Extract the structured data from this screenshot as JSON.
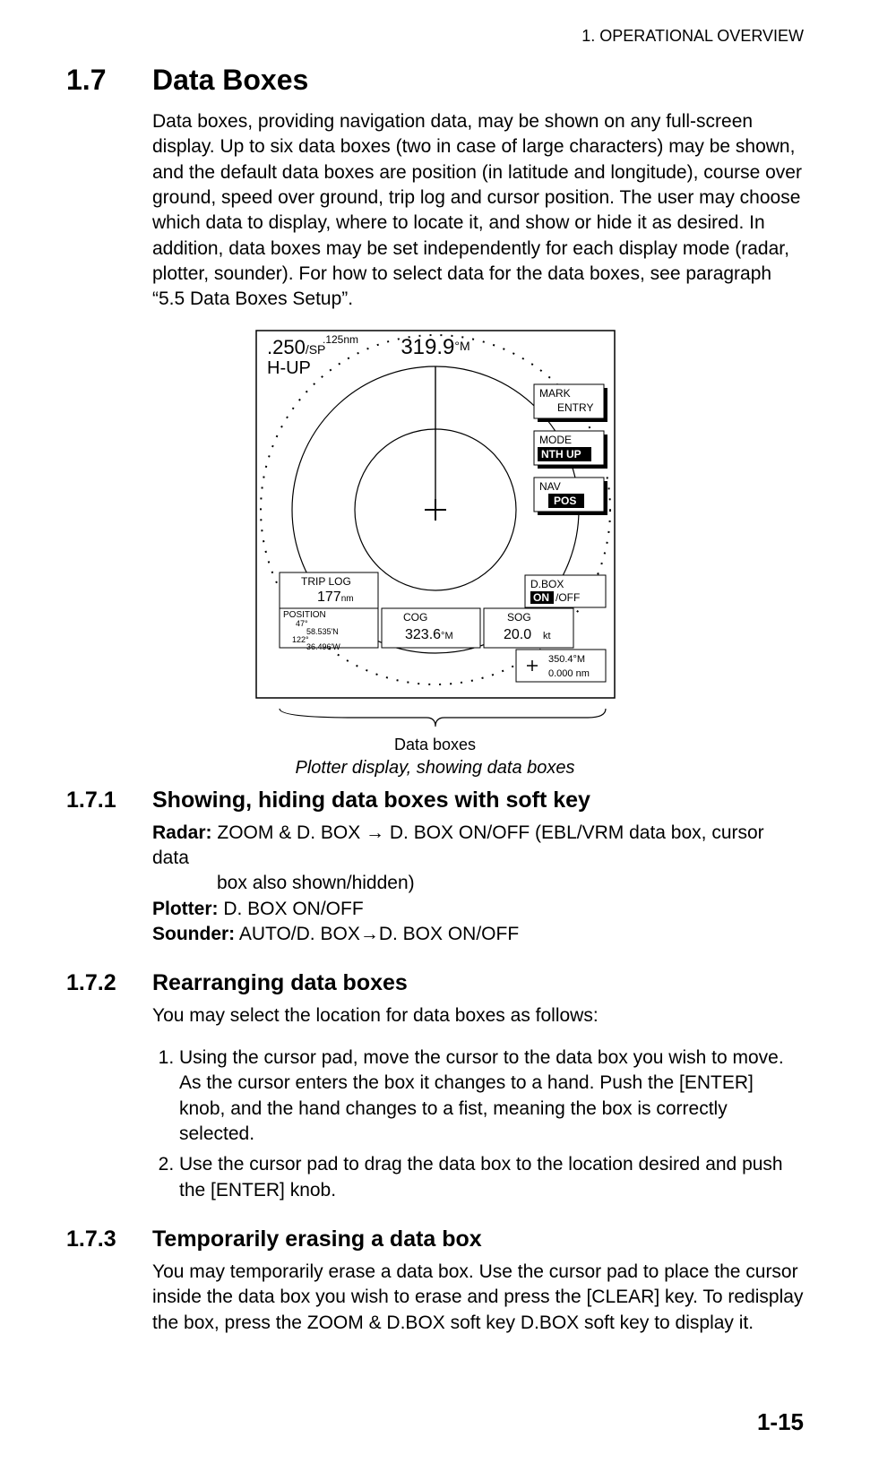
{
  "running_head": "1. OPERATIONAL OVERVIEW",
  "section": {
    "num": "1.7",
    "title": "Data Boxes",
    "para": "Data boxes, providing navigation data, may be shown on any full-screen display. Up to six data boxes (two in case of large characters) may be shown, and the default data boxes are position (in latitude and longitude), course over ground, speed over ground, trip log and cursor position. The user may choose which data to display, where to locate it, and show or hide it as desired. In addition, data boxes may be set independently for each display mode (radar, plotter, sounder). For how to select data for the data boxes, see paragraph “5.5 Data Boxes Setup”."
  },
  "figure": {
    "range": ".250",
    "sp": "/SP",
    "range_unit": ".125nm",
    "hup": "H-UP",
    "hdg": "319.9",
    "hdg_deg": "°M",
    "softkeys": {
      "mark": {
        "l1": "MARK",
        "l2": "ENTRY"
      },
      "mode": {
        "l1": "MODE",
        "l2": "NTH UP"
      },
      "nav": {
        "l1": "NAV",
        "l2": "POS"
      },
      "dbox": {
        "l1": "D.BOX",
        "on": "ON",
        "off": "/OFF"
      }
    },
    "boxes": {
      "triplog": {
        "title": "TRIP LOG",
        "val": "177",
        "unit": "nm"
      },
      "position": {
        "title": "POSITION",
        "lat1": "47°",
        "lat2": "58.535'N",
        "lon1": "122°",
        "lon2": "36.496'W"
      },
      "cog": {
        "title": "COG",
        "val": "323.6",
        "unit": "°M"
      },
      "sog": {
        "title": "SOG",
        "val": "20.0",
        "unit": "kt"
      },
      "cursor": {
        "l1a": "350.4",
        "l1b": "°M",
        "l2": "0.000 nm"
      }
    },
    "brace_label": "Data boxes",
    "caption": "Plotter display, showing data boxes"
  },
  "s171": {
    "num": "1.7.1",
    "title": "Showing, hiding data boxes with soft key",
    "radar_lead": "Radar:",
    "radar_txt1": " ZOOM & D. BOX → D. BOX ON/OFF (EBL/VRM data box, cursor data",
    "radar_txt2": "box also shown/hidden)",
    "plotter_lead": "Plotter:",
    "plotter_txt": " D. BOX ON/OFF",
    "sounder_lead": "Sounder:",
    "sounder_txt": " AUTO/D. BOX→D. BOX ON/OFF"
  },
  "s172": {
    "num": "1.7.2",
    "title": "Rearranging data boxes",
    "intro": "You may select the location for data boxes as follows:",
    "step1": "Using the cursor pad, move the cursor to the data box you wish to move. As the cursor enters the box it changes to a hand. Push the [ENTER] knob, and the hand changes to a fist, meaning the box is correctly selected.",
    "step2": "Use the cursor pad to drag the data box to the location desired and push the [ENTER] knob."
  },
  "s173": {
    "num": "1.7.3",
    "title": "Temporarily erasing a data box",
    "para": "You may temporarily erase a data box. Use the cursor pad to place the cursor inside the data box you wish to erase and press the [CLEAR] key. To redisplay the box, press the ZOOM & D.BOX soft key D.BOX soft key to display it."
  },
  "page_number": "1-15"
}
